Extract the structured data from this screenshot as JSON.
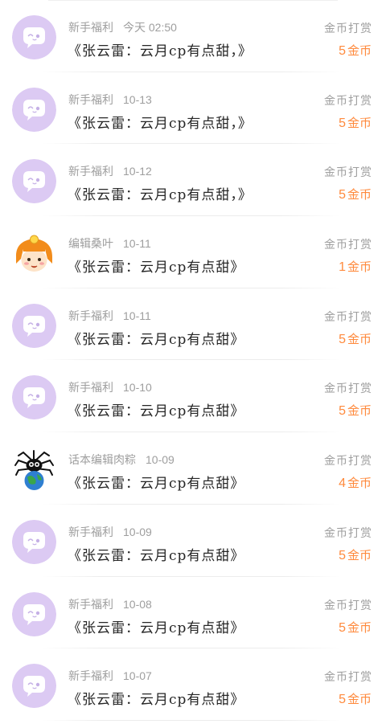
{
  "tip_label": "金币打赏",
  "coin_unit": "金币",
  "items": [
    {
      "name": "新手福利",
      "date": "今天 02:50",
      "title": "《张云雷：云月cp有点甜，》",
      "coins": "5",
      "avatar": "bubble"
    },
    {
      "name": "新手福利",
      "date": "10-13",
      "title": "《张云雷：云月cp有点甜，》",
      "coins": "5",
      "avatar": "bubble"
    },
    {
      "name": "新手福利",
      "date": "10-12",
      "title": "《张云雷：云月cp有点甜，》",
      "coins": "5",
      "avatar": "bubble"
    },
    {
      "name": "编辑桑叶",
      "date": "10-11",
      "title": "《张云雷：云月cp有点甜》",
      "coins": "1",
      "avatar": "cartoon-girl"
    },
    {
      "name": "新手福利",
      "date": "10-11",
      "title": "《张云雷：云月cp有点甜》",
      "coins": "5",
      "avatar": "bubble"
    },
    {
      "name": "新手福利",
      "date": "10-10",
      "title": "《张云雷：云月cp有点甜》",
      "coins": "5",
      "avatar": "bubble"
    },
    {
      "name": "话本编辑肉粽",
      "date": "10-09",
      "title": "《张云雷：云月cp有点甜》",
      "coins": "4",
      "avatar": "spider-globe"
    },
    {
      "name": "新手福利",
      "date": "10-09",
      "title": "《张云雷：云月cp有点甜》",
      "coins": "5",
      "avatar": "bubble"
    },
    {
      "name": "新手福利",
      "date": "10-08",
      "title": "《张云雷：云月cp有点甜》",
      "coins": "5",
      "avatar": "bubble"
    },
    {
      "name": "新手福利",
      "date": "10-07",
      "title": "《张云雷：云月cp有点甜》",
      "coins": "5",
      "avatar": "bubble"
    }
  ],
  "colors": {
    "accent": "#ff8a3d",
    "avatar_bg": "#d9c7f2",
    "muted_text": "#9e9e9e",
    "main_text": "#262626"
  }
}
